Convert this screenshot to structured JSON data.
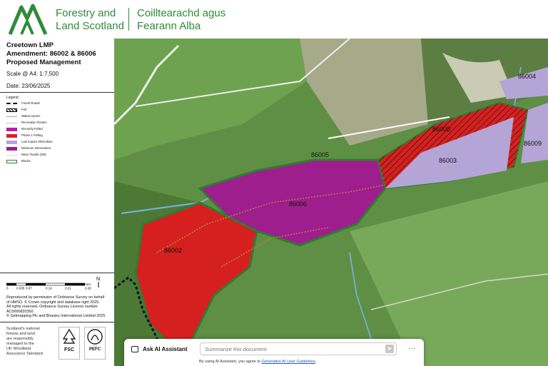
{
  "header": {
    "org_name_en": "Forestry and\nLand Scotland",
    "org_name_ga": "Coilltearachd agus\nFearann Alba",
    "brand_color": "#2e8b3a"
  },
  "panel": {
    "title": "Creetown LMP\nAmendment: 86002 & 86006\nProposed Management",
    "scale_label": "Scale @ A4:",
    "scale_value": "1:7,500",
    "date": "Date: 23/06/2025",
    "legend_title": "Legend",
    "legend": [
      {
        "label": "Forest Roads",
        "style": "forest-road"
      },
      {
        "label": "Fell",
        "style": "hatch"
      },
      {
        "label": "Watercourses",
        "style": "water",
        "color": "#7ab2e6"
      },
      {
        "label": "Recreation Routes",
        "style": "dotted",
        "color": "#b58b34"
      },
      {
        "label": "Recently Felled",
        "style": "fill",
        "color": "#c218a8"
      },
      {
        "label": "Phase 1 Felling",
        "style": "fill",
        "color": "#d62020"
      },
      {
        "label": "Low Impact Silviculture",
        "style": "fill",
        "color": "#b4a5d6"
      },
      {
        "label": "Minimum Intervention",
        "style": "fill",
        "color": "#9e1e8e"
      },
      {
        "label": "Minor Roads (GB)",
        "style": "road",
        "color": "#eed9c0"
      },
      {
        "label": "Blocks",
        "style": "outline",
        "color": "#2e7d32"
      }
    ],
    "scalebar_ticks": [
      "0",
      "0.035",
      "0.07",
      "0.14",
      "0.21",
      "0.28"
    ],
    "scalebar_unit": "km",
    "north": "N",
    "credits": "Reproduced by permission of Ordnance Survey on behalf\nof HMSO. © Crown copyright and database right 2025.\nAll rights reserved. Ordnance Survey Licence number\nAC0000820350.\n© Getmapping Plc and Bluesky International Limited 2025.",
    "cert_text": "Scotland's national\nforests and land\nare responsibly\nmanaged to the\nUK Woodland\nAssurance Standard.",
    "fsc_label": "FSC",
    "pefc_label": "PEFC"
  },
  "map": {
    "labels": [
      "86002",
      "86005",
      "86006",
      "86003",
      "86008",
      "86004",
      "86009"
    ]
  },
  "ai_assistant": {
    "label": "Ask AI Assistant",
    "placeholder": "Summarize this document",
    "disclaimer_prefix": "By using AI Assistant, you agree to ",
    "disclaimer_link": "Generative AI User Guidelines",
    "more": "···"
  }
}
